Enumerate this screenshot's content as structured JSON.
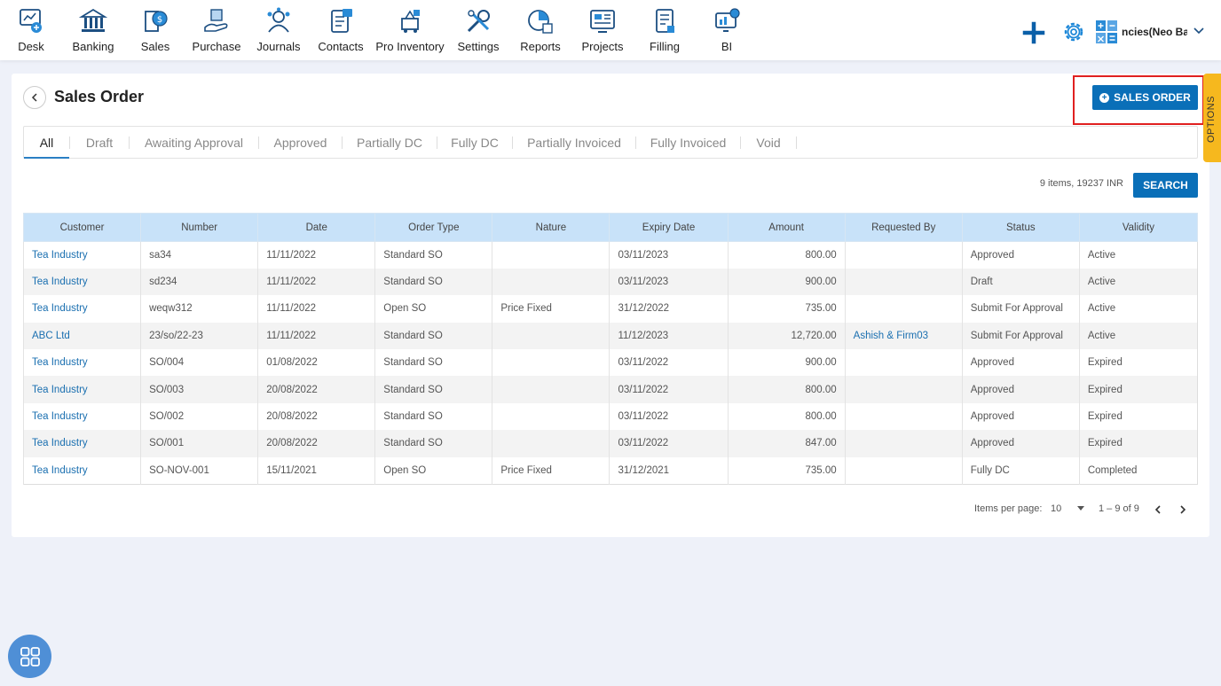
{
  "nav": [
    {
      "label": "Desk",
      "icon": "desk-icon"
    },
    {
      "label": "Banking",
      "icon": "bank-icon"
    },
    {
      "label": "Sales",
      "icon": "sales-icon"
    },
    {
      "label": "Purchase",
      "icon": "purchase-icon"
    },
    {
      "label": "Journals",
      "icon": "journals-icon"
    },
    {
      "label": "Contacts",
      "icon": "contacts-icon"
    },
    {
      "label": "Pro Inventory",
      "icon": "inventory-icon"
    },
    {
      "label": "Settings",
      "icon": "settings-icon"
    },
    {
      "label": "Reports",
      "icon": "reports-icon"
    },
    {
      "label": "Projects",
      "icon": "projects-icon"
    },
    {
      "label": "Filling",
      "icon": "filling-icon"
    },
    {
      "label": "BI",
      "icon": "bi-icon"
    }
  ],
  "header_right": {
    "company": "ncies(Neo Ba",
    "icons": [
      "plus-icon",
      "gear-icon",
      "calculator-icon",
      "chevron-down-icon"
    ]
  },
  "page": {
    "title": "Sales Order",
    "new_button": "SALES ORDER",
    "options_label": "OPTIONS",
    "items_info": "9 items, 19237 INR",
    "search_button": "SEARCH"
  },
  "tabs": [
    "All",
    "Draft",
    "Awaiting Approval",
    "Approved",
    "Partially DC",
    "Fully DC",
    "Partially Invoiced",
    "Fully Invoiced",
    "Void"
  ],
  "active_tab": "All",
  "table": {
    "columns": [
      "Customer",
      "Number",
      "Date",
      "Order Type",
      "Nature",
      "Expiry Date",
      "Amount",
      "Requested By",
      "Status",
      "Validity"
    ],
    "rows": [
      [
        "Tea Industry",
        "sa34",
        "11/11/2022",
        "Standard SO",
        "",
        "03/11/2023",
        "800.00",
        "",
        "Approved",
        "Active"
      ],
      [
        "Tea Industry",
        "sd234",
        "11/11/2022",
        "Standard SO",
        "",
        "03/11/2023",
        "900.00",
        "",
        "Draft",
        "Active"
      ],
      [
        "Tea Industry",
        "weqw312",
        "11/11/2022",
        "Open SO",
        "Price Fixed",
        "31/12/2022",
        "735.00",
        "",
        "Submit For Approval",
        "Active"
      ],
      [
        "ABC Ltd",
        "23/so/22-23",
        "11/11/2022",
        "Standard SO",
        "",
        "11/12/2023",
        "12,720.00",
        "Ashish & Firm03",
        "Submit For Approval",
        "Active"
      ],
      [
        "Tea Industry",
        "SO/004",
        "01/08/2022",
        "Standard SO",
        "",
        "03/11/2022",
        "900.00",
        "",
        "Approved",
        "Expired"
      ],
      [
        "Tea Industry",
        "SO/003",
        "20/08/2022",
        "Standard SO",
        "",
        "03/11/2022",
        "800.00",
        "",
        "Approved",
        "Expired"
      ],
      [
        "Tea Industry",
        "SO/002",
        "20/08/2022",
        "Standard SO",
        "",
        "03/11/2022",
        "800.00",
        "",
        "Approved",
        "Expired"
      ],
      [
        "Tea Industry",
        "SO/001",
        "20/08/2022",
        "Standard SO",
        "",
        "03/11/2022",
        "847.00",
        "",
        "Approved",
        "Expired"
      ],
      [
        "Tea Industry",
        "SO-NOV-001",
        "15/11/2021",
        "Open SO",
        "Price Fixed",
        "31/12/2021",
        "735.00",
        "",
        "Fully DC",
        "Completed"
      ]
    ]
  },
  "pagination": {
    "label": "Items per page:",
    "page_size": "10",
    "range": "1 – 9 of 9"
  },
  "colors": {
    "accent": "#0a6fb8",
    "header_row": "#c8e2f9",
    "highlight": "#e02020",
    "options_tab": "#f6b81e"
  }
}
